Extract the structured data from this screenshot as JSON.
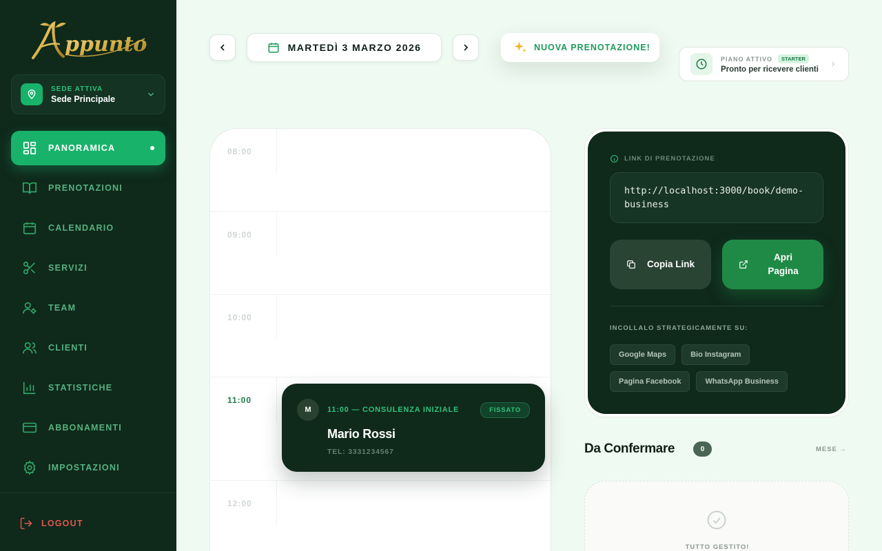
{
  "brand": {
    "logo_text": "Appunto"
  },
  "sede": {
    "label": "SEDE ATTIVA",
    "name": "Sede Principale"
  },
  "nav": [
    {
      "label": "PANORAMICA",
      "icon": "grid-icon",
      "active": true
    },
    {
      "label": "PRENOTAZIONI",
      "icon": "book-icon",
      "active": false
    },
    {
      "label": "CALENDARIO",
      "icon": "calendar-icon",
      "active": false
    },
    {
      "label": "SERVIZI",
      "icon": "scissors-icon",
      "active": false
    },
    {
      "label": "TEAM",
      "icon": "user-gear-icon",
      "active": false
    },
    {
      "label": "CLIENTI",
      "icon": "users-icon",
      "active": false
    },
    {
      "label": "STATISTICHE",
      "icon": "bar-chart-icon",
      "active": false
    },
    {
      "label": "ABBONAMENTI",
      "icon": "credit-card-icon",
      "active": false
    },
    {
      "label": "IMPOSTAZIONI",
      "icon": "gear-icon",
      "active": false
    }
  ],
  "logout": {
    "label": "LOGOUT"
  },
  "topbar": {
    "date": "MARTEDÌ 3 MARZO 2026",
    "new_booking": "NUOVA PRENOTAZIONE!",
    "plan_label": "PIANO ATTIVO",
    "plan_badge": "STARTER",
    "plan_status": "Pronto per ricevere clienti"
  },
  "schedule": {
    "slots": [
      "08:00",
      "09:00",
      "10:00",
      "11:00",
      "12:00"
    ],
    "current_slot": "11:00"
  },
  "appointment": {
    "initial": "M",
    "time_service": "11:00 — CONSULENZA INIZIALE",
    "status": "FISSATO",
    "client": "Mario Rossi",
    "phone": "TEL: 3331234567"
  },
  "booking_link": {
    "label": "LINK DI PRENOTAZIONE",
    "url": "http://localhost:3000/book/demo-business",
    "copy_label": "Copia Link",
    "open_label": "Apri Pagina",
    "paste_label": "INCOLLALO STRATEGICAMENTE SU:",
    "chips": [
      "Google Maps",
      "Bio Instagram",
      "Pagina Facebook",
      "WhatsApp Business"
    ]
  },
  "to_confirm": {
    "title": "Da Confermare",
    "count": "0",
    "month_link": "MESE →",
    "empty": "TUTTO GESTITO!"
  },
  "colors": {
    "sidebar_bg": "#0f291b",
    "accent": "#19b26b",
    "logout": "#e0584c",
    "gold": "#d9b24a"
  }
}
